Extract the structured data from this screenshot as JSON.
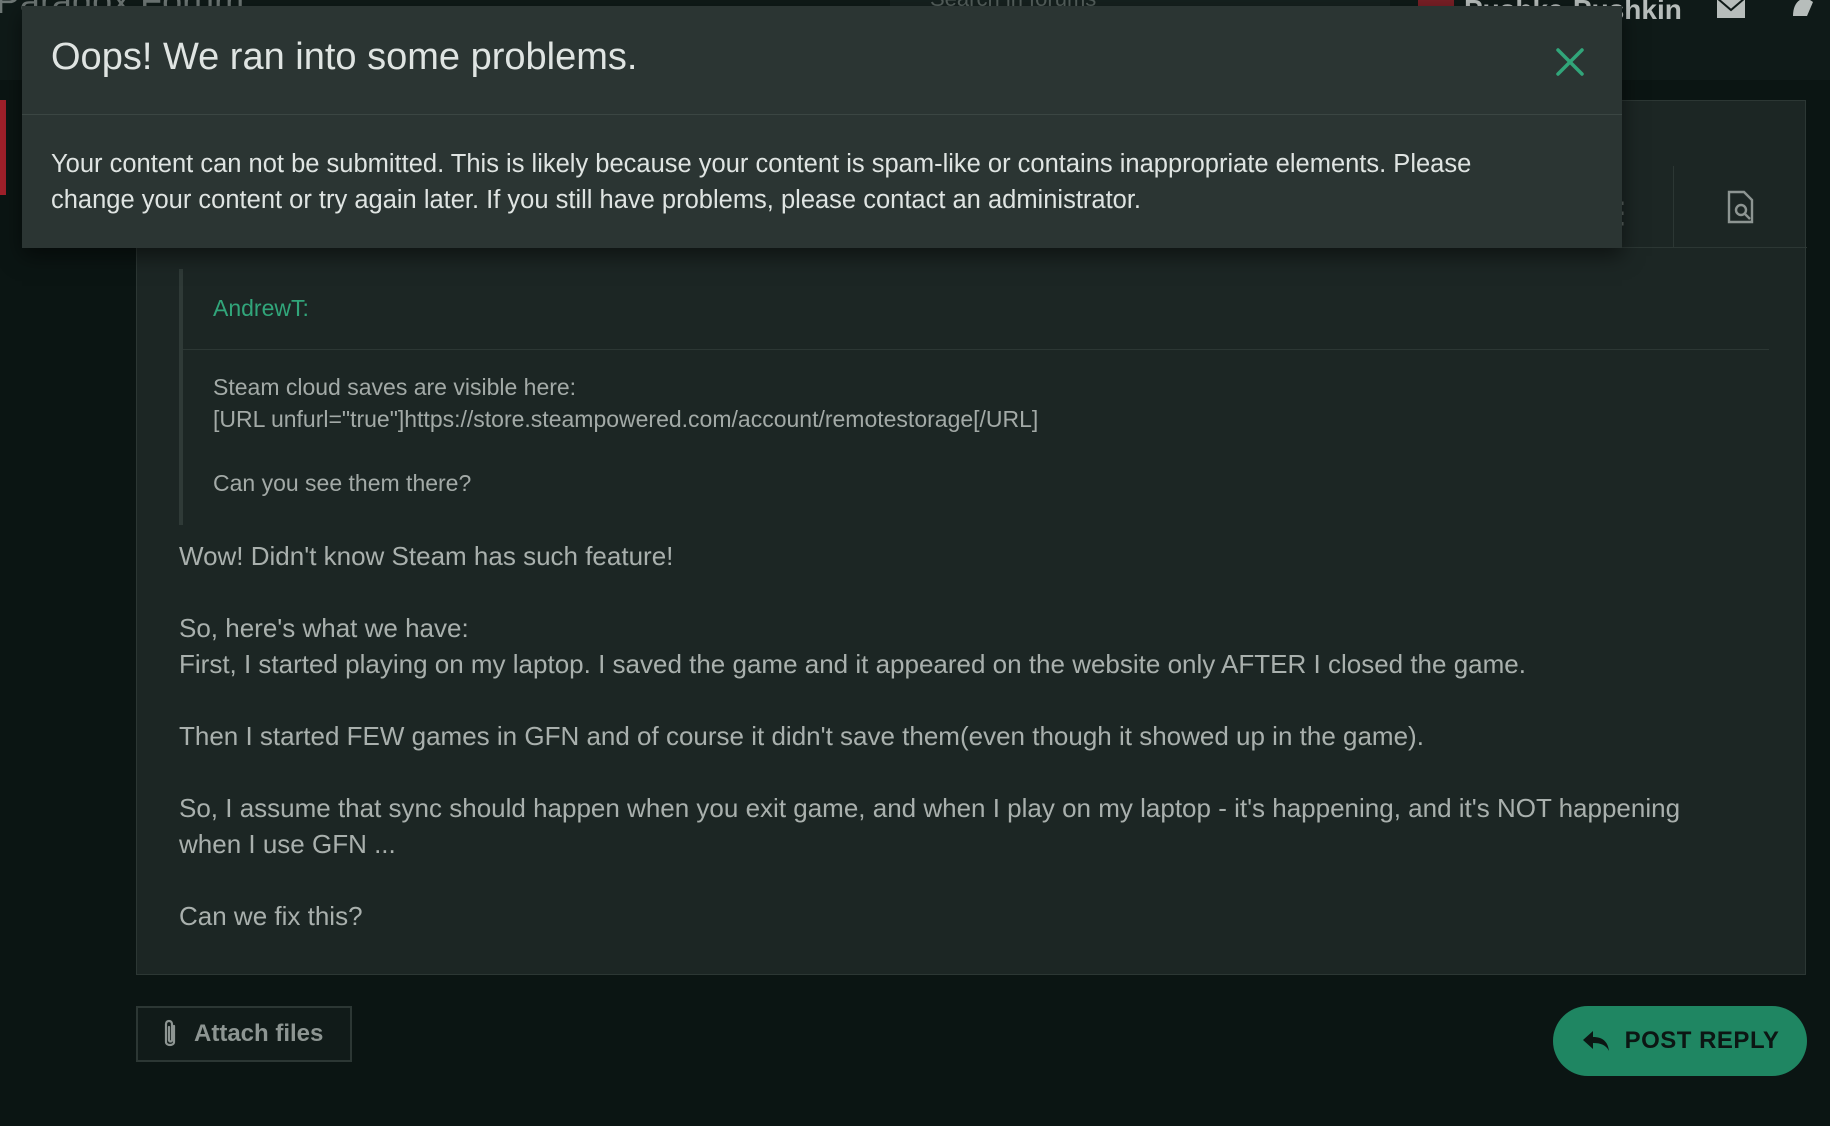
{
  "header": {
    "forum_title": "Paradox Forum",
    "search_placeholder": "Search in forums",
    "username": "Pushka-Pushkin"
  },
  "editor": {
    "quote": {
      "author": "AndrewT:",
      "lines": [
        "Steam cloud saves are visible here:",
        "[URL unfurl=\"true\"]https://store.steampowered.com/account/remotestorage[/URL]",
        "Can you see them there?"
      ]
    },
    "body_lines": [
      "Wow! Didn't know Steam has such feature!",
      "So, here's what we have:",
      "First, I started playing on my laptop. I saved the game and it appeared on the website only AFTER I closed the game.",
      "Then I started FEW games in GFN and of course it didn't save them(even though it showed up in the game).",
      "So, I assume that sync should happen when you exit game, and when I play on my laptop - it's happening, and it's NOT happening",
      "when I use GFN ...",
      "Can we fix this?"
    ]
  },
  "actions": {
    "attach_label": "Attach files",
    "post_reply_label": "POST REPLY"
  },
  "modal": {
    "title": "Oops! We ran into some problems.",
    "message_line1": "Your content can not be submitted. This is likely because your content is spam-like or contains inappropriate elements. Please",
    "message_line2": "change your content or try again later. If you still have problems, please contact an administrator."
  },
  "colors": {
    "accent": "#31a57a",
    "button": "#1f8662",
    "modal_bg": "#2b3533",
    "page_bg": "#0b1513"
  }
}
